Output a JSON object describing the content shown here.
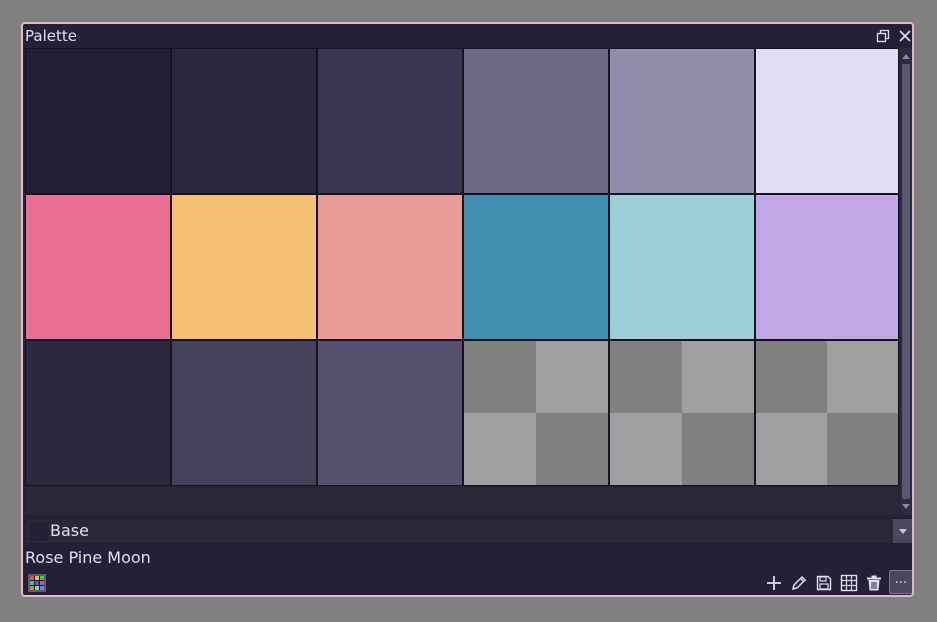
{
  "window": {
    "title": "Palette"
  },
  "titlebar": {
    "buttons": [
      "restore-icon",
      "close-icon"
    ]
  },
  "palette": {
    "columns": 6,
    "swatches": [
      "#232136",
      "#2a273f",
      "#393552",
      "#6e6a86",
      "#908caa",
      "#e0def4",
      "#eb6f92",
      "#f6c177",
      "#ea9a97",
      "#3e8fb0",
      "#9ccfd8",
      "#c4a7e7",
      "#2a283e",
      "#44415a",
      "#56526e",
      null,
      null,
      null
    ],
    "empty_swatch_colors": [
      "#808080",
      "#a0a0a2"
    ]
  },
  "group_select": {
    "value": "Base"
  },
  "palette_name": "Rose Pine Moon",
  "footer": {
    "left_icon": "palette-grid-icon",
    "buttons": [
      "add-icon",
      "edit-icon",
      "save-icon",
      "grid-icon",
      "delete-icon"
    ],
    "more_label": "..."
  },
  "colors": {
    "window_bg": "#232136",
    "border_accent": "#e6b6c9",
    "text": "#e0def4"
  }
}
